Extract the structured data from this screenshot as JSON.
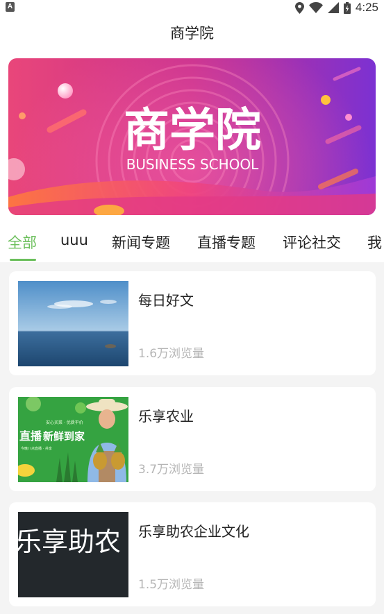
{
  "status_bar": {
    "app_badge": "A",
    "time": "4:25",
    "icons": [
      "location-icon",
      "wifi-icon",
      "signal-icon",
      "battery-icon"
    ]
  },
  "header": {
    "title": "商学院"
  },
  "banner": {
    "title": "商学院",
    "subtitle": "BUSINESS SCHOOL",
    "colors": {
      "left": "#e8407a",
      "mid": "#c62f8e",
      "right": "#7b2fd0"
    }
  },
  "tabs": [
    {
      "label": "全部",
      "active": true
    },
    {
      "label": "uuu",
      "active": false
    },
    {
      "label": "新闻专题",
      "active": false
    },
    {
      "label": "直播专题",
      "active": false
    },
    {
      "label": "评论社交",
      "active": false
    },
    {
      "label": "我",
      "active": false
    }
  ],
  "accent_color": "#6bbf5b",
  "articles": [
    {
      "title": "每日好文",
      "views": "1.6万浏览量",
      "thumb": "sea-photo"
    },
    {
      "title": "乐享农业",
      "views": "3.7万浏览量",
      "thumb": "farmer-pineapple-poster",
      "thumb_text": {
        "top": "安心买菜 · 优质平价",
        "headline_a": "直播",
        "headline_b": "新鲜到家",
        "bottom": "今晚八点直播 · 共享"
      }
    },
    {
      "title": "乐享助农企业文化",
      "views": "1.5万浏览量",
      "thumb": "text-tile",
      "thumb_text": "乐享助农"
    }
  ]
}
